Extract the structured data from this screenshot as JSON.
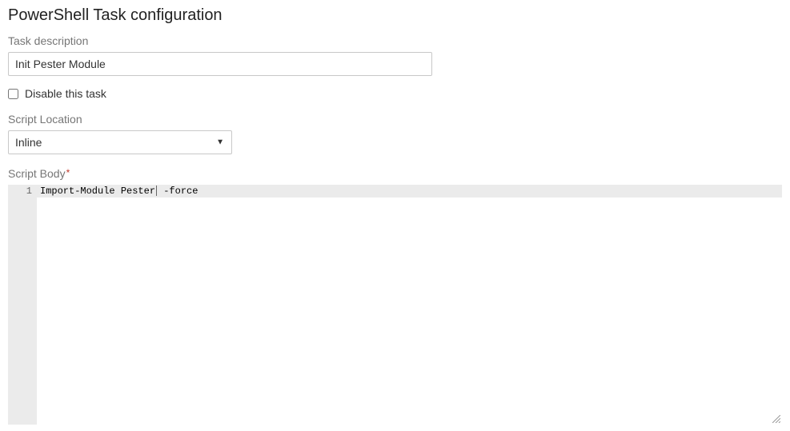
{
  "page": {
    "title": "PowerShell Task configuration"
  },
  "fields": {
    "task_description_label": "Task description",
    "task_description_value": "Init Pester Module",
    "disable_task_label": "Disable this task",
    "disable_task_checked": false,
    "script_location_label": "Script Location",
    "script_location_value": "Inline",
    "script_body_label": "Script Body"
  },
  "code": {
    "lines": [
      {
        "num": "1",
        "text_a": "Import-Module Pester",
        "text_b": " -force"
      }
    ]
  }
}
